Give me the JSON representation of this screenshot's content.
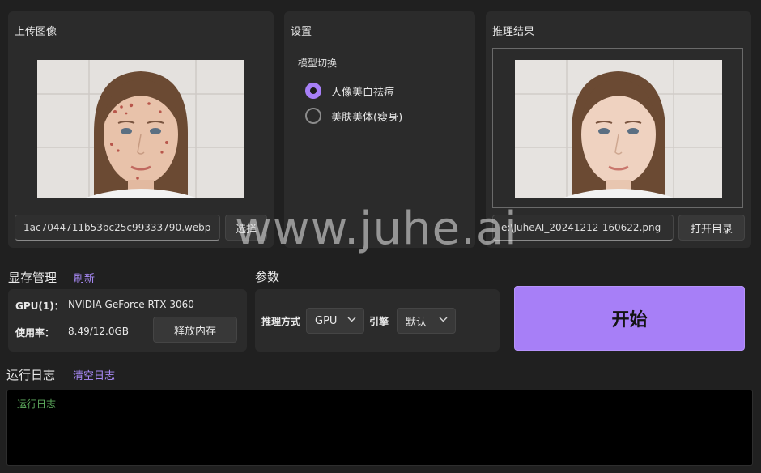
{
  "upload": {
    "title": "上传图像",
    "filename": "1ac7044711b53bc25c99333790.webp",
    "select_label": "选择"
  },
  "settings": {
    "title": "设置",
    "model_switch_label": "模型切换",
    "options": [
      {
        "label": "人像美白祛痘",
        "selected": true
      },
      {
        "label": "美肤美体(瘦身)",
        "selected": false
      }
    ]
  },
  "result": {
    "title": "推理结果",
    "filename": "e:\\JuheAI_20241212-160622.png",
    "open_dir_label": "打开目录"
  },
  "memory": {
    "title": "显存管理",
    "refresh_label": "刷新",
    "gpu_label": "GPU(1)：",
    "gpu_name": "NVIDIA GeForce RTX 3060",
    "usage_label": "使用率：",
    "usage_value": "8.49/12.0GB",
    "release_label": "释放内存"
  },
  "params": {
    "title": "参数",
    "inference_label": "推理方式",
    "inference_value": "GPU",
    "engine_label": "引擎",
    "engine_value": "默认"
  },
  "start": {
    "label": "开始"
  },
  "log": {
    "title": "运行日志",
    "clear_label": "清空日志",
    "text": "运行日志"
  },
  "watermark": {
    "text": "www.juhe.ai"
  },
  "colors": {
    "accent": "#a77ff7",
    "link": "#a98af7",
    "log_text": "#5fae5f"
  }
}
